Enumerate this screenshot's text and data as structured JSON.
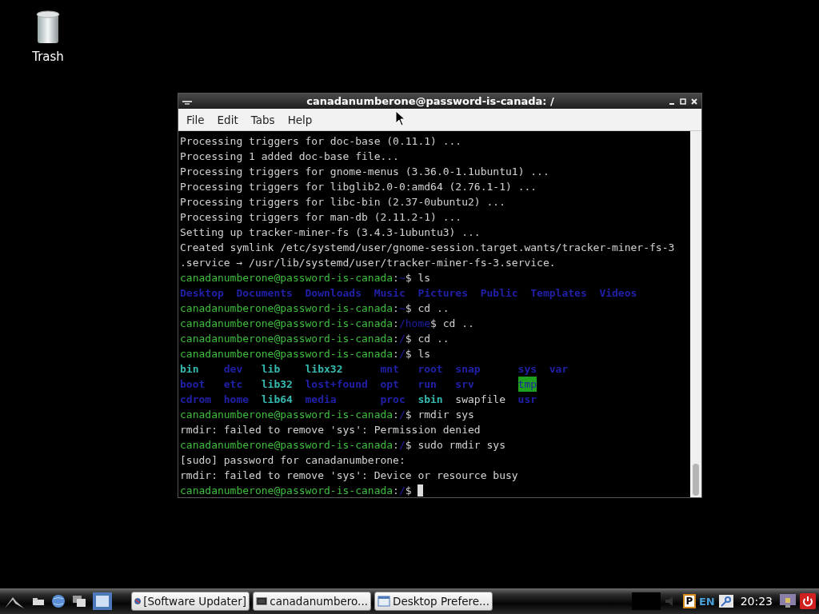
{
  "desktop": {
    "icons": [
      {
        "label": "Trash"
      }
    ]
  },
  "terminal": {
    "title": "canadanumberone@password-is-canada: /",
    "menu": [
      "File",
      "Edit",
      "Tabs",
      "Help"
    ],
    "lines": [
      {
        "kind": "text",
        "segments": [
          {
            "kind": "plain",
            "text": "Processing triggers for doc-base (0.11.1) ..."
          }
        ]
      },
      {
        "kind": "text",
        "segments": [
          {
            "kind": "plain",
            "text": "Processing 1 added doc-base file..."
          }
        ]
      },
      {
        "kind": "text",
        "segments": [
          {
            "kind": "plain",
            "text": "Processing triggers for gnome-menus (3.36.0-1.1ubuntu1) ..."
          }
        ]
      },
      {
        "kind": "text",
        "segments": [
          {
            "kind": "plain",
            "text": "Processing triggers for libglib2.0-0:amd64 (2.76.1-1) ..."
          }
        ]
      },
      {
        "kind": "text",
        "segments": [
          {
            "kind": "plain",
            "text": "Processing triggers for libc-bin (2.37-0ubuntu2) ..."
          }
        ]
      },
      {
        "kind": "text",
        "segments": [
          {
            "kind": "plain",
            "text": "Processing triggers for man-db (2.11.2-1) ..."
          }
        ]
      },
      {
        "kind": "text",
        "segments": [
          {
            "kind": "plain",
            "text": "Setting up tracker-miner-fs (3.4.3-1ubuntu3) ..."
          }
        ]
      },
      {
        "kind": "text",
        "segments": [
          {
            "kind": "plain",
            "text": "Created symlink /etc/systemd/user/gnome-session.target.wants/tracker-miner-fs-3"
          }
        ]
      },
      {
        "kind": "text",
        "segments": [
          {
            "kind": "plain",
            "text": ".service → /usr/lib/systemd/user/tracker-miner-fs-3.service."
          }
        ]
      },
      {
        "kind": "text",
        "segments": [
          {
            "kind": "user",
            "text": "canadanumberone@password-is-canada"
          },
          {
            "kind": "plain",
            "text": ":"
          },
          {
            "kind": "path",
            "text": "~"
          },
          {
            "kind": "plain",
            "text": "$ ls"
          }
        ]
      },
      {
        "kind": "listing",
        "rows": [
          [
            {
              "kind": "dir",
              "text": "Desktop"
            },
            {
              "kind": "dir",
              "text": "Documents"
            },
            {
              "kind": "dir",
              "text": "Downloads"
            },
            {
              "kind": "dir",
              "text": "Music"
            },
            {
              "kind": "dir",
              "text": "Pictures"
            },
            {
              "kind": "dir",
              "text": "Public"
            },
            {
              "kind": "dir",
              "text": "Templates"
            },
            {
              "kind": "dir",
              "text": "Videos"
            }
          ]
        ]
      },
      {
        "kind": "text",
        "segments": [
          {
            "kind": "user",
            "text": "canadanumberone@password-is-canada"
          },
          {
            "kind": "plain",
            "text": ":"
          },
          {
            "kind": "path",
            "text": "~"
          },
          {
            "kind": "plain",
            "text": "$ cd .."
          }
        ]
      },
      {
        "kind": "text",
        "segments": [
          {
            "kind": "user",
            "text": "canadanumberone@password-is-canada"
          },
          {
            "kind": "plain",
            "text": ":"
          },
          {
            "kind": "path",
            "text": "/home"
          },
          {
            "kind": "plain",
            "text": "$ cd .."
          }
        ]
      },
      {
        "kind": "text",
        "segments": [
          {
            "kind": "user",
            "text": "canadanumberone@password-is-canada"
          },
          {
            "kind": "plain",
            "text": ":"
          },
          {
            "kind": "path",
            "text": "/"
          },
          {
            "kind": "plain",
            "text": "$ cd .."
          }
        ]
      },
      {
        "kind": "text",
        "segments": [
          {
            "kind": "user",
            "text": "canadanumberone@password-is-canada"
          },
          {
            "kind": "plain",
            "text": ":"
          },
          {
            "kind": "path",
            "text": "/"
          },
          {
            "kind": "plain",
            "text": "$ ls"
          }
        ]
      },
      {
        "kind": "listing",
        "rows": [
          [
            {
              "kind": "link",
              "text": "bin"
            },
            {
              "kind": "dir",
              "text": "dev"
            },
            {
              "kind": "link",
              "text": "lib"
            },
            {
              "kind": "link",
              "text": "libx32"
            },
            {
              "kind": "dir",
              "text": "mnt"
            },
            {
              "kind": "dir",
              "text": "root"
            },
            {
              "kind": "dir",
              "text": "snap"
            },
            {
              "kind": "dir",
              "text": "sys"
            },
            {
              "kind": "dir",
              "text": "var"
            }
          ],
          [
            {
              "kind": "dir",
              "text": "boot"
            },
            {
              "kind": "dir",
              "text": "etc"
            },
            {
              "kind": "link",
              "text": "lib32"
            },
            {
              "kind": "dir",
              "text": "lost+found"
            },
            {
              "kind": "dir",
              "text": "opt"
            },
            {
              "kind": "dir",
              "text": "run"
            },
            {
              "kind": "dir",
              "text": "srv"
            },
            {
              "kind": "sticky",
              "text": "tmp"
            }
          ],
          [
            {
              "kind": "dir",
              "text": "cdrom"
            },
            {
              "kind": "dir",
              "text": "home"
            },
            {
              "kind": "link",
              "text": "lib64"
            },
            {
              "kind": "dir",
              "text": "media"
            },
            {
              "kind": "dir",
              "text": "proc"
            },
            {
              "kind": "link",
              "text": "sbin"
            },
            {
              "kind": "plain",
              "text": "swapfile"
            },
            {
              "kind": "dir",
              "text": "usr"
            }
          ]
        ]
      },
      {
        "kind": "text",
        "segments": [
          {
            "kind": "user",
            "text": "canadanumberone@password-is-canada"
          },
          {
            "kind": "plain",
            "text": ":"
          },
          {
            "kind": "path",
            "text": "/"
          },
          {
            "kind": "plain",
            "text": "$ rmdir sys"
          }
        ]
      },
      {
        "kind": "text",
        "segments": [
          {
            "kind": "plain",
            "text": "rmdir: failed to remove 'sys': Permission denied"
          }
        ]
      },
      {
        "kind": "text",
        "segments": [
          {
            "kind": "user",
            "text": "canadanumberone@password-is-canada"
          },
          {
            "kind": "plain",
            "text": ":"
          },
          {
            "kind": "path",
            "text": "/"
          },
          {
            "kind": "plain",
            "text": "$ sudo rmdir sys"
          }
        ]
      },
      {
        "kind": "text",
        "segments": [
          {
            "kind": "plain",
            "text": "[sudo] password for canadanumberone:"
          }
        ]
      },
      {
        "kind": "text",
        "segments": [
          {
            "kind": "plain",
            "text": "rmdir: failed to remove 'sys': Device or resource busy"
          }
        ]
      },
      {
        "kind": "text",
        "segments": [
          {
            "kind": "user",
            "text": "canadanumberone@password-is-canada"
          },
          {
            "kind": "plain",
            "text": ":"
          },
          {
            "kind": "path",
            "text": "/"
          },
          {
            "kind": "plain",
            "text": "$ "
          }
        ]
      }
    ]
  },
  "taskbar": {
    "tasks": [
      {
        "label": "[Software Updater]"
      },
      {
        "label": "canadanumbero..."
      },
      {
        "label": "Desktop Prefere..."
      }
    ],
    "tray_badge": "P",
    "keyboard_layout": "EN",
    "clock": "20:23"
  }
}
